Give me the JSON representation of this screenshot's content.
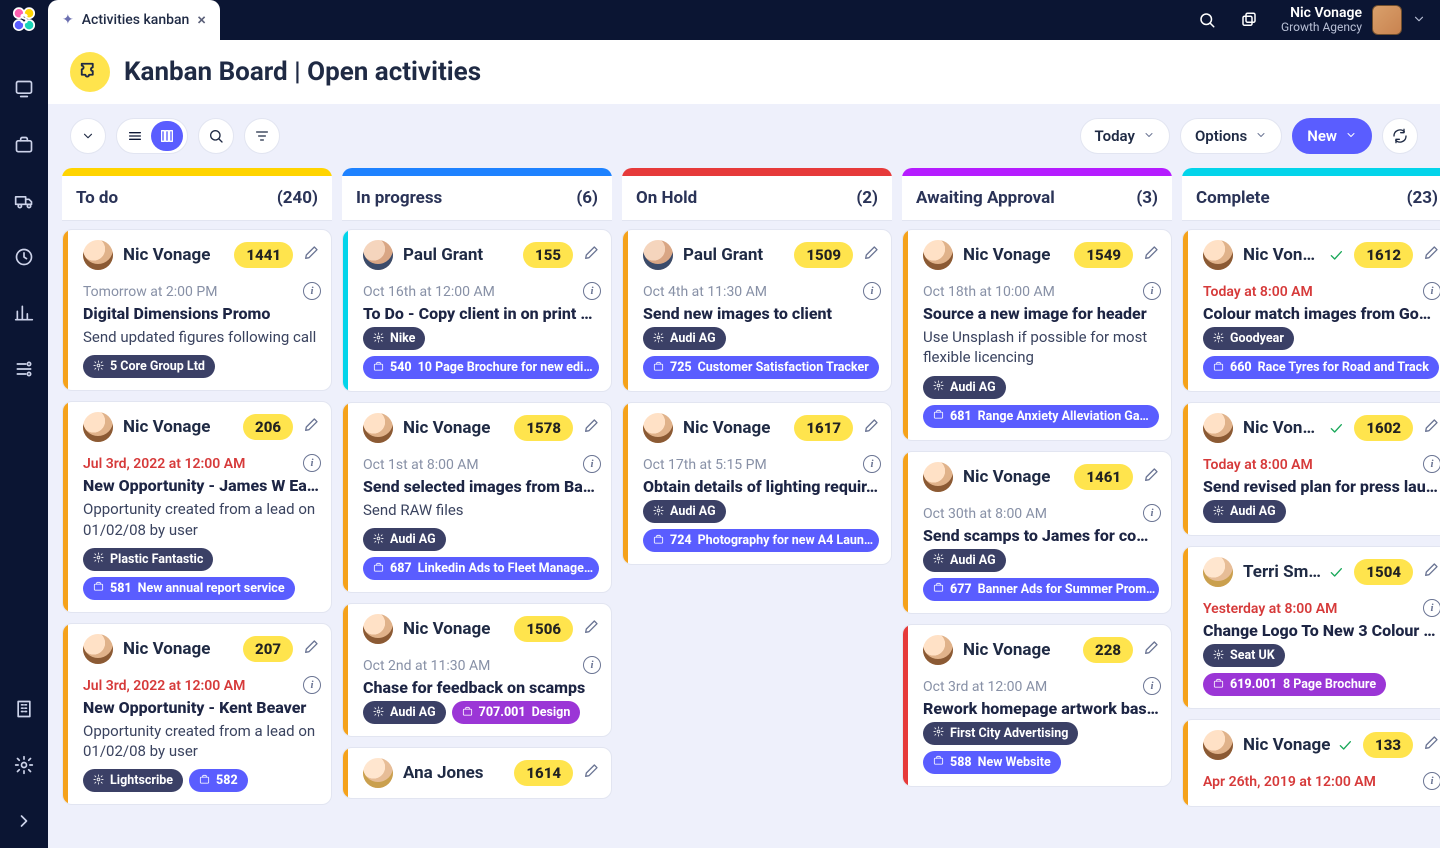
{
  "app": {
    "tab_label": "Activities kanban",
    "user_name": "Nic Vonage",
    "user_sub": "Growth Agency"
  },
  "header": {
    "title": "Kanban Board | Open activities"
  },
  "toolbar": {
    "today": "Today",
    "options": "Options",
    "new": "New"
  },
  "columns": [
    {
      "id": "todo",
      "title": "To do",
      "count": "(240)",
      "bar": "yellow"
    },
    {
      "id": "prog",
      "title": "In progress",
      "count": "(6)",
      "bar": "blue"
    },
    {
      "id": "hold",
      "title": "On Hold",
      "count": "(2)",
      "bar": "red"
    },
    {
      "id": "await",
      "title": "Awaiting Approval",
      "count": "(3)",
      "bar": "purple"
    },
    {
      "id": "done",
      "title": "Complete",
      "count": "(23)",
      "bar": "cyan"
    }
  ],
  "cards": {
    "todo": [
      {
        "accent": "orange",
        "avatar": "f",
        "owner": "Nic Vonage",
        "num": "1441",
        "when": "Tomorrow at 2:00 PM",
        "when_danger": false,
        "title": "Digital Dimensions Promo",
        "desc": "Send updated figures following call",
        "chips": [
          {
            "type": "dark",
            "icon": "gear",
            "text": "5 Core Group Ltd"
          }
        ]
      },
      {
        "accent": "orange",
        "avatar": "f",
        "owner": "Nic Vonage",
        "num": "206",
        "when": "Jul 3rd, 2022 at 12:00 AM",
        "when_danger": true,
        "title": "New Opportunity - James W Ea…",
        "desc": "Opportunity created from a lead on 01/02/08 by user",
        "chips": [
          {
            "type": "dark",
            "icon": "gear",
            "text": "Plastic Fantastic"
          },
          {
            "type": "primary",
            "icon": "brief",
            "ref": "581",
            "text": "New annual report service"
          }
        ]
      },
      {
        "accent": "orange",
        "avatar": "f",
        "owner": "Nic Vonage",
        "num": "207",
        "when": "Jul 3rd, 2022 at 12:00 AM",
        "when_danger": true,
        "title": "New Opportunity - Kent Beaver",
        "desc": "Opportunity created from a lead on 01/02/08 by user",
        "chips": [
          {
            "type": "dark",
            "icon": "gear",
            "text": "Lightscribe"
          },
          {
            "type": "primary",
            "icon": "brief",
            "ref": "582",
            "text": ""
          }
        ]
      }
    ],
    "prog": [
      {
        "accent": "cyan",
        "avatar": "m",
        "owner": "Paul Grant",
        "num": "155",
        "when": "Oct 16th at 12:00 AM",
        "when_danger": false,
        "title": "To Do - Copy client in on print s…",
        "desc": "",
        "chips": [
          {
            "type": "dark",
            "icon": "gear",
            "text": "Nike"
          },
          {
            "type": "primary",
            "icon": "brief",
            "ref": "540",
            "text": "10 Page Brochure for new edi…"
          }
        ]
      },
      {
        "accent": "orange",
        "avatar": "f",
        "owner": "Nic Vonage",
        "num": "1578",
        "when": "Oct 1st at 8:00 AM",
        "when_danger": false,
        "title": "Send selected images from Bar…",
        "desc": "Send RAW files",
        "chips": [
          {
            "type": "dark",
            "icon": "gear",
            "text": "Audi AG"
          },
          {
            "type": "primary",
            "icon": "brief",
            "ref": "687",
            "text": "Linkedin Ads to Fleet Manage…"
          }
        ]
      },
      {
        "accent": "orange",
        "avatar": "f",
        "owner": "Nic Vonage",
        "num": "1506",
        "when": "Oct 2nd at 11:30 AM",
        "when_danger": false,
        "title": "Chase for feedback on scamps",
        "desc": "",
        "chips": [
          {
            "type": "dark",
            "icon": "gear",
            "text": "Audi AG"
          },
          {
            "type": "purple",
            "icon": "brief",
            "ref": "707.001",
            "text": "Design"
          }
        ]
      },
      {
        "accent": "orange",
        "avatar": "blonde",
        "owner": "Ana Jones",
        "num": "1614",
        "when": "",
        "when_danger": false,
        "title": "",
        "desc": "",
        "chips": []
      }
    ],
    "hold": [
      {
        "accent": "orange",
        "avatar": "m",
        "owner": "Paul Grant",
        "num": "1509",
        "when": "Oct 4th at 11:30 AM",
        "when_danger": false,
        "title": "Send new images to client",
        "desc": "",
        "chips": [
          {
            "type": "dark",
            "icon": "gear",
            "text": "Audi AG"
          },
          {
            "type": "primary",
            "icon": "brief",
            "ref": "725",
            "text": "Customer Satisfaction Tracker"
          }
        ]
      },
      {
        "accent": "orange",
        "avatar": "f",
        "owner": "Nic Vonage",
        "num": "1617",
        "when": "Oct 17th at 5:15 PM",
        "when_danger": false,
        "title": "Obtain details of lighting requir…",
        "desc": "",
        "chips": [
          {
            "type": "dark",
            "icon": "gear",
            "text": "Audi AG"
          },
          {
            "type": "primary",
            "icon": "brief",
            "ref": "724",
            "text": "Photography for new A4 Laun…"
          }
        ]
      }
    ],
    "await": [
      {
        "accent": "orange",
        "avatar": "f",
        "owner": "Nic Vonage",
        "num": "1549",
        "when": "Oct 18th at 10:00 AM",
        "when_danger": false,
        "title": "Source a new image for header",
        "desc": "Use Unsplash if possible for most flexible licencing",
        "chips": [
          {
            "type": "dark",
            "icon": "gear",
            "text": "Audi AG"
          },
          {
            "type": "primary",
            "icon": "brief",
            "ref": "681",
            "text": "Range Anxiety Alleviation Ga…"
          }
        ]
      },
      {
        "accent": "orange",
        "avatar": "f",
        "owner": "Nic Vonage",
        "num": "1461",
        "when": "Oct 30th at 8:00 AM",
        "when_danger": false,
        "title": "Send scamps to James for com…",
        "desc": "",
        "chips": [
          {
            "type": "dark",
            "icon": "gear",
            "text": "Audi AG"
          },
          {
            "type": "primary",
            "icon": "brief",
            "ref": "677",
            "text": "Banner Ads for Summer Prom…"
          }
        ]
      },
      {
        "accent": "red",
        "avatar": "f",
        "owner": "Nic Vonage",
        "num": "228",
        "when": "Oct 3rd at 12:00 AM",
        "when_danger": false,
        "title": "Rework homepage artwork bas…",
        "desc": "",
        "chips": [
          {
            "type": "dark",
            "icon": "gear",
            "text": "First City Advertising"
          },
          {
            "type": "primary",
            "icon": "brief",
            "ref": "588",
            "text": "New Website"
          }
        ]
      }
    ],
    "done": [
      {
        "accent": "orange",
        "avatar": "f",
        "owner": "Nic Vonage",
        "check": true,
        "num": "1612",
        "when": "Today at 8:00 AM",
        "when_danger": true,
        "title": "Colour match images from Goo…",
        "desc": "",
        "chips": [
          {
            "type": "dark",
            "icon": "gear",
            "text": "Goodyear"
          },
          {
            "type": "primary",
            "icon": "brief",
            "ref": "660",
            "text": "Race Tyres for Road and Track"
          }
        ]
      },
      {
        "accent": "orange",
        "avatar": "f",
        "owner": "Nic Vona…",
        "check": true,
        "num": "1602",
        "when": "Today at 8:00 AM",
        "when_danger": true,
        "title": "Send revised plan for press lau…",
        "desc": "",
        "chips": [
          {
            "type": "dark",
            "icon": "gear",
            "text": "Audi AG"
          }
        ]
      },
      {
        "accent": "orange",
        "avatar": "blonde",
        "owner": "Terri Smith",
        "check": true,
        "num": "1504",
        "when": "Yesterday at 8:00 AM",
        "when_danger": true,
        "title": "Change Logo To New 3 Colour …",
        "desc": "",
        "chips": [
          {
            "type": "dark",
            "icon": "gear",
            "text": "Seat UK"
          },
          {
            "type": "purple",
            "icon": "brief",
            "ref": "619.001",
            "text": "8 Page Brochure"
          }
        ]
      },
      {
        "accent": "orange",
        "avatar": "f",
        "owner": "Nic Vonage",
        "check": true,
        "num": "133",
        "when": "Apr 26th, 2019 at 12:00 AM",
        "when_danger": true,
        "title": "",
        "desc": "",
        "chips": []
      }
    ]
  }
}
